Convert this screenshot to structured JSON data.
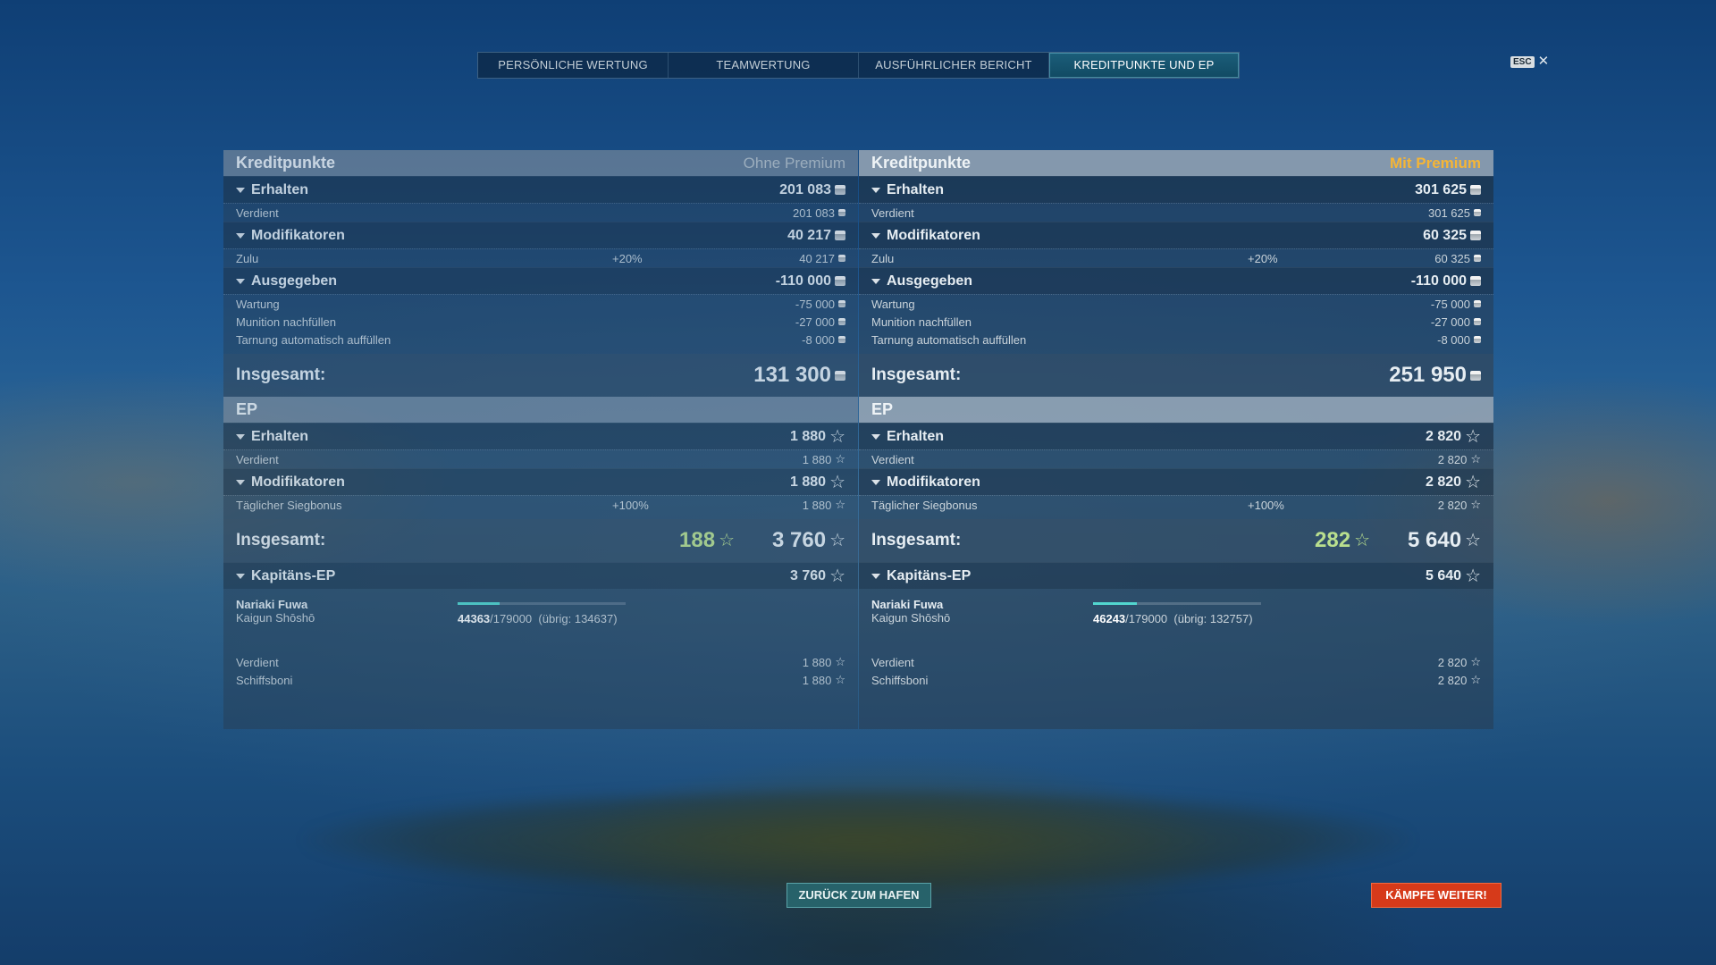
{
  "tabs": [
    {
      "label": "PERSÖNLICHE WERTUNG"
    },
    {
      "label": "TEAMWERTUNG"
    },
    {
      "label": "AUSFÜHRLICHER BERICHT"
    },
    {
      "label": "KREDITPUNKTE UND EP",
      "active": true
    }
  ],
  "close": {
    "key": "ESC",
    "icon": "close-icon"
  },
  "left": {
    "credits": {
      "title": "Kreditpunkte",
      "premium": "Ohne Premium",
      "received": {
        "label": "Erhalten",
        "value": "201 083"
      },
      "earned": {
        "label": "Verdient",
        "value": "201 083"
      },
      "modifiers": {
        "label": "Modifikatoren",
        "value": "40 217"
      },
      "zulu": {
        "label": "Zulu",
        "pct": "+20%",
        "value": "40 217"
      },
      "spent": {
        "label": "Ausgegeben",
        "value": "-110 000"
      },
      "maintenance": {
        "label": "Wartung",
        "value": "-75 000"
      },
      "ammo": {
        "label": "Munition nachfüllen",
        "value": "-27 000"
      },
      "camo": {
        "label": "Tarnung automatisch auffüllen",
        "value": "-8 000"
      },
      "total": {
        "label": "Insgesamt:",
        "value": "131 300"
      }
    },
    "xp": {
      "title": "EP",
      "received": {
        "label": "Erhalten",
        "value": "1 880"
      },
      "earned": {
        "label": "Verdient",
        "value": "1 880"
      },
      "modifiers": {
        "label": "Modifikatoren",
        "value": "1 880"
      },
      "daily": {
        "label": "Täglicher Siegbonus",
        "pct": "+100%",
        "value": "1 880"
      },
      "total": {
        "label": "Insgesamt:",
        "free": "188",
        "value": "3 760"
      }
    },
    "captain": {
      "label": "Kapitäns-EP",
      "value": "3 760",
      "name": "Nariaki Fuwa",
      "rank": "Kaigun Shōshō",
      "current": "44363",
      "max": "/179000",
      "remaining": "(übrig: 134637)",
      "progress": 0.248,
      "earned": {
        "label": "Verdient",
        "value": "1 880"
      },
      "ship": {
        "label": "Schiffsboni",
        "value": "1 880"
      }
    }
  },
  "right": {
    "credits": {
      "title": "Kreditpunkte",
      "premium": "Mit Premium",
      "received": {
        "label": "Erhalten",
        "value": "301 625"
      },
      "earned": {
        "label": "Verdient",
        "value": "301 625"
      },
      "modifiers": {
        "label": "Modifikatoren",
        "value": "60 325"
      },
      "zulu": {
        "label": "Zulu",
        "pct": "+20%",
        "value": "60 325"
      },
      "spent": {
        "label": "Ausgegeben",
        "value": "-110 000"
      },
      "maintenance": {
        "label": "Wartung",
        "value": "-75 000"
      },
      "ammo": {
        "label": "Munition nachfüllen",
        "value": "-27 000"
      },
      "camo": {
        "label": "Tarnung automatisch auffüllen",
        "value": "-8 000"
      },
      "total": {
        "label": "Insgesamt:",
        "value": "251 950"
      }
    },
    "xp": {
      "title": "EP",
      "received": {
        "label": "Erhalten",
        "value": "2 820"
      },
      "earned": {
        "label": "Verdient",
        "value": "2 820"
      },
      "modifiers": {
        "label": "Modifikatoren",
        "value": "2 820"
      },
      "daily": {
        "label": "Täglicher Siegbonus",
        "pct": "+100%",
        "value": "2 820"
      },
      "total": {
        "label": "Insgesamt:",
        "free": "282",
        "value": "5 640"
      }
    },
    "captain": {
      "label": "Kapitäns-EP",
      "value": "5 640",
      "name": "Nariaki Fuwa",
      "rank": "Kaigun Shōshō",
      "current": "46243",
      "max": "/179000",
      "remaining": "(übrig: 132757)",
      "progress": 0.258,
      "earned": {
        "label": "Verdient",
        "value": "2 820"
      },
      "ship": {
        "label": "Schiffsboni",
        "value": "2 820"
      }
    }
  },
  "buttons": {
    "back": "ZURÜCK ZUM HAFEN",
    "fight": "KÄMPFE WEITER!"
  }
}
